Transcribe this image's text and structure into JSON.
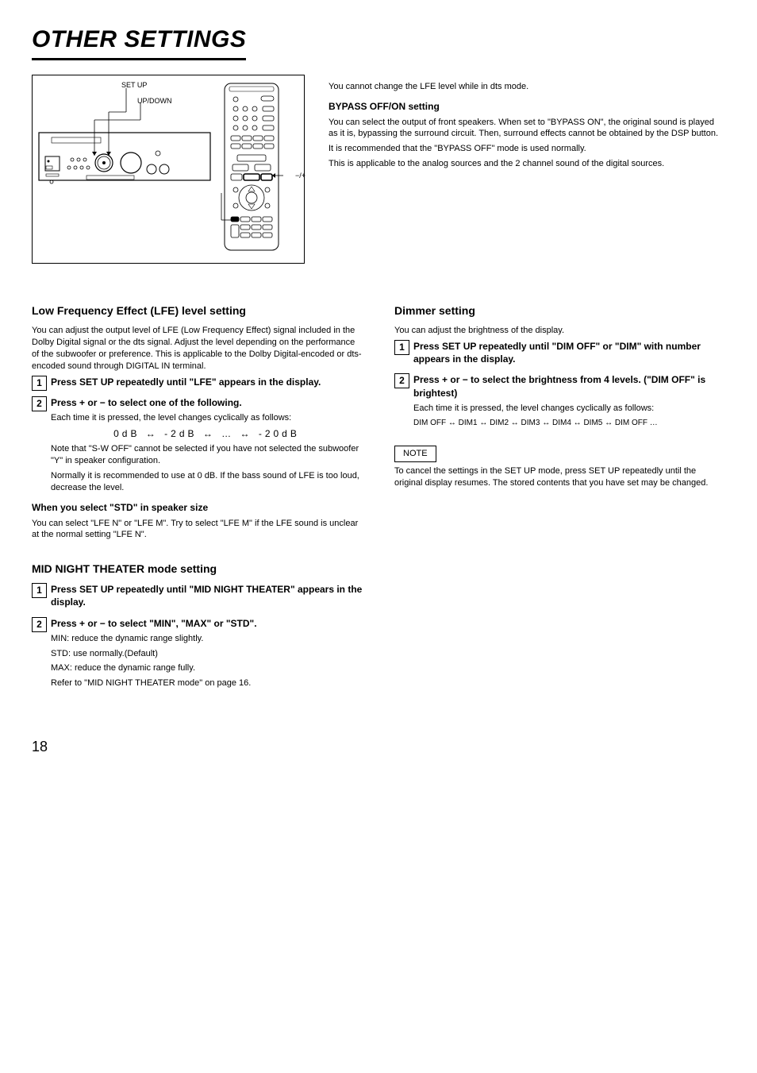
{
  "heading": "OTHER SETTINGS",
  "page_number": "18",
  "callouts": {
    "setup": "SET UP",
    "uvd": "UP/DOWN",
    "minus_plus": "−/+",
    "setup_r": "SET UP",
    "uvd_r": "UP/DOWN"
  },
  "left": {
    "title": "Low Frequency Effect (LFE) level setting",
    "desc": "You can adjust the output level of LFE (Low Frequency Effect) signal included in the Dolby Digital signal or the dts signal. Adjust the level depending on the performance of the subwoofer or preference. This is applicable to the Dolby Digital-encoded or dts-encoded sound through DIGITAL IN terminal.",
    "step1_head": "Press SET UP repeatedly until \"LFE\" appears in the display.",
    "step2_head": "Press + or − to select one of the following.",
    "step2_body": "Each time it is pressed, the level changes cyclically as follows:",
    "cycle": "0dB ↔ -2dB ↔ … ↔ -20dB",
    "step2_note1": "Note that \"S-W OFF\" cannot be selected if you have not selected the subwoofer \"Y\" in speaker configuration.",
    "step2_note2": "Normally it is recommended to use at 0 dB. If the bass sound of LFE is too loud, decrease the level.",
    "sub_title": "When you select \"STD\" in speaker size",
    "sub_body": "You can select \"LFE N\" or \"LFE M\". Try to select \"LFE M\" if the LFE sound is unclear at the normal setting \"LFE N\".",
    "mnt_title": "MID NIGHT THEATER mode setting",
    "mnt_step1_head": "Press SET UP repeatedly until \"MID NIGHT THEATER\" appears in the display.",
    "mnt_step2_head": "Press + or − to select \"MIN\", \"MAX\" or \"STD\".",
    "mnt_min": "MIN: reduce the dynamic range slightly.",
    "mnt_std": "STD: use normally.(Default)",
    "mnt_max": "MAX: reduce the dynamic range fully.",
    "mnt_ref": "Refer to \"MID NIGHT THEATER mode\" on page 16."
  },
  "right": {
    "dts_notice": "You cannot change the LFE level while in dts mode.",
    "bypass_title": "BYPASS OFF/ON setting",
    "bypass_desc": "You can select the output of front speakers. When set to \"BYPASS ON\", the original sound is played as it is, bypassing the surround circuit. Then, surround effects cannot be obtained by the DSP button.",
    "bypass_desc2": "It is recommended that the \"BYPASS OFF\" mode is used normally.",
    "bypass_desc3": "This is applicable to the analog sources and the 2 channel sound of the digital sources.",
    "dim_title": "Dimmer setting",
    "dim_body": "You can adjust the brightness of the display.",
    "dim_step1": "Press SET UP repeatedly until \"DIM OFF\" or \"DIM\" with number appears in the display.",
    "dim_step2": "Press + or − to select the brightness from 4 levels. (\"DIM OFF\" is brightest)",
    "dim_cycle": "Each time it is pressed, the level changes cyclically as follows:",
    "dim_cycle_vals": "DIM OFF ↔ DIM1 ↔ DIM2 ↔ DIM3 ↔ DIM4 ↔ DIM5 ↔ DIM OFF …",
    "note_hdr": "NOTE",
    "note_body": "To cancel the settings in the SET UP mode, press SET UP repeatedly until the original display resumes. The stored contents that you have set may be changed."
  }
}
